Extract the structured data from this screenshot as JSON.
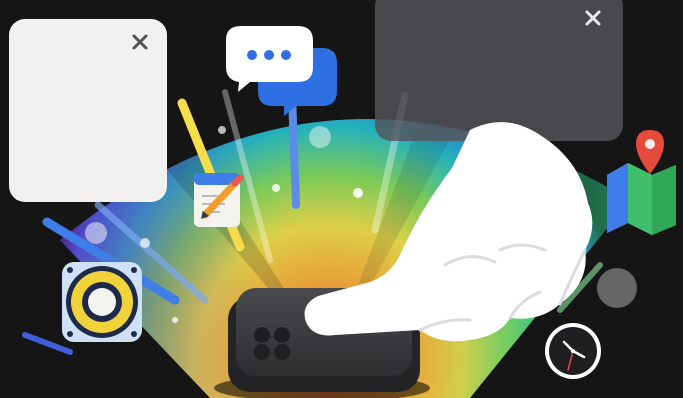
{
  "scene": {
    "background_color": "#151515",
    "rainbow_colors": [
      "#2a2ab0",
      "#1e6fe0",
      "#16b6c8",
      "#35d07a",
      "#c7e04a",
      "#f3c43a",
      "#f08a2c",
      "#e8432e",
      "#a833b8",
      "#5b2bb5"
    ],
    "left_window": {
      "icon": "close-icon",
      "color": "#f2f1ef"
    },
    "right_window": {
      "icon": "close-icon",
      "color": "#4a4a4c"
    },
    "icons": [
      "chat-bubble-icon",
      "notepad-pencil-icon",
      "speaker-icon",
      "map-pin-icon",
      "clock-icon"
    ],
    "hand": {
      "icon": "pointing-hand-icon",
      "color": "#ffffff"
    },
    "key": {
      "icon": "command-key-icon",
      "color": "#3a3a3d"
    }
  }
}
